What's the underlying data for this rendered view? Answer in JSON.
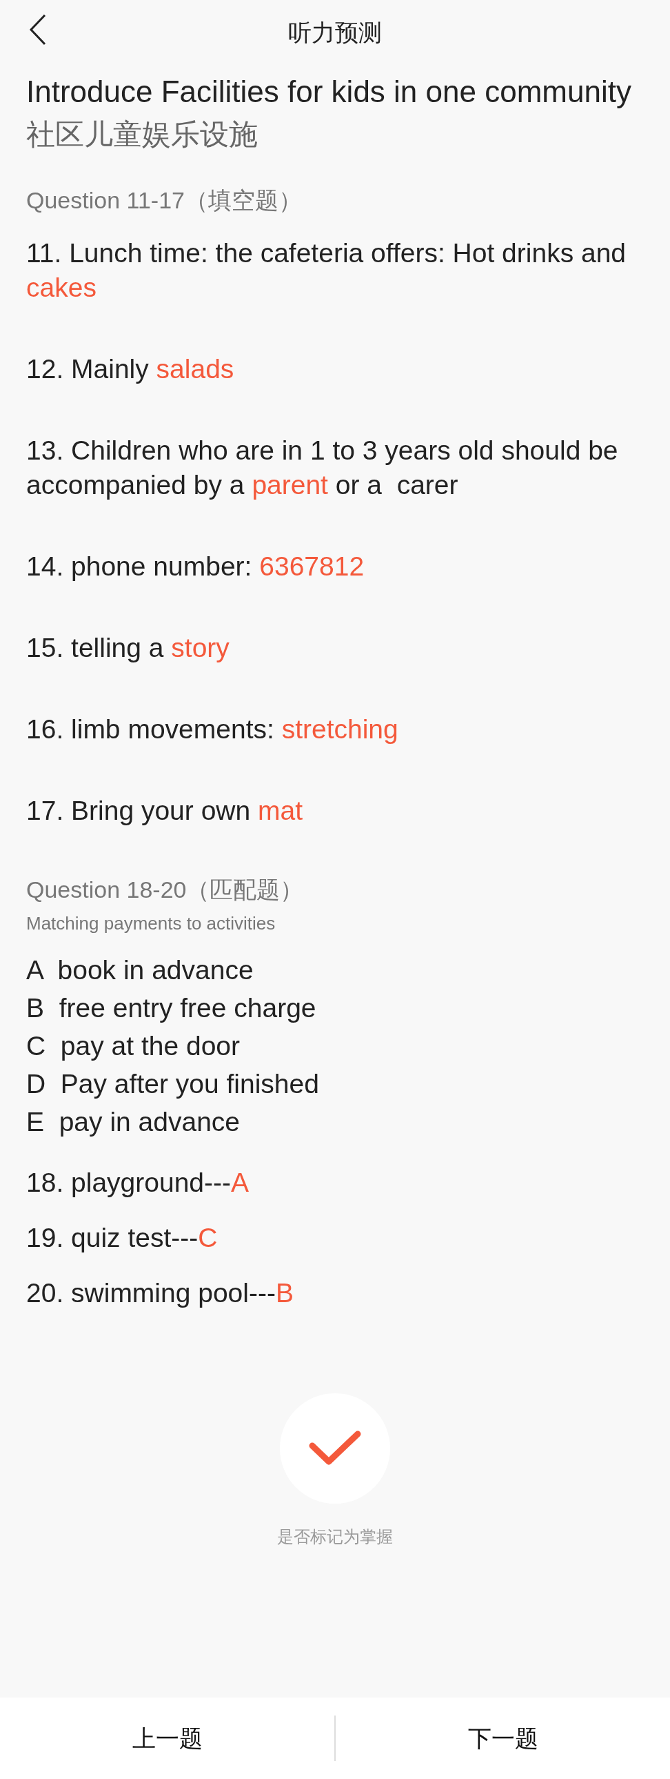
{
  "header": {
    "title": "听力预测"
  },
  "title": "Introduce Facilities for kids in one community",
  "subtitle": "社区儿童娱乐设施",
  "section1": {
    "heading": "Question 11-17（填空题）",
    "items": [
      {
        "prefix": "11. Lunch time: the cafeteria offers: Hot drinks and ",
        "answer": "cakes"
      },
      {
        "prefix": "12. Mainly ",
        "answer": "salads"
      },
      {
        "prefix": "13. Children who are in 1 to 3 years old should be accompanied by a ",
        "answer": "parent",
        "suffix": " or a  carer"
      },
      {
        "prefix": "14. phone number: ",
        "answer": "6367812"
      },
      {
        "prefix": "15. telling a ",
        "answer": "story"
      },
      {
        "prefix": "16. limb movements: ",
        "answer": "stretching"
      },
      {
        "prefix": "17. Bring your own ",
        "answer": "mat"
      }
    ]
  },
  "section2": {
    "heading": "Question 18-20（匹配题）",
    "subheading": "Matching payments to activities",
    "options": [
      "A  book in advance",
      "B  free entry free charge",
      "C  pay at the door",
      "D  Pay after you finished",
      "E  pay in advance"
    ],
    "items": [
      {
        "prefix": "18. playground---",
        "answer": "A"
      },
      {
        "prefix": "19. quiz test---",
        "answer": "C"
      },
      {
        "prefix": "20. swimming pool---",
        "answer": "B"
      }
    ]
  },
  "mastery": {
    "marked": true,
    "label": "是否标记为掌握"
  },
  "footer": {
    "prev": "上一题",
    "next": "下一题"
  }
}
